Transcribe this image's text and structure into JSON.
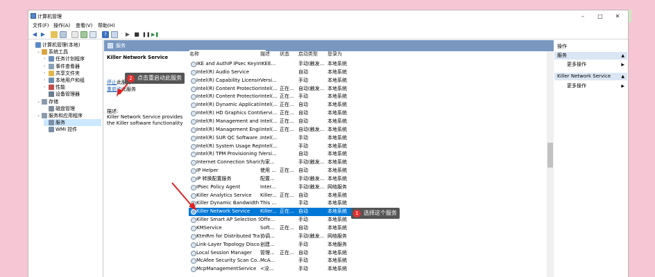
{
  "window": {
    "title": "计算机管理",
    "controls": {
      "minimize": "–",
      "maximize": "□",
      "close": "✕"
    }
  },
  "menu": [
    "文件(F)",
    "操作(A)",
    "查看(V)",
    "帮助(H)"
  ],
  "tree": {
    "items": [
      {
        "label": "计算机管理(本地)",
        "depth": 0,
        "expander": "",
        "icon_color": "#5a87c7",
        "selected": false
      },
      {
        "label": "系统工具",
        "depth": 1,
        "expander": "⌄",
        "icon_color": "#d9a441",
        "selected": false
      },
      {
        "label": "任务计划程序",
        "depth": 2,
        "expander": "›",
        "icon_color": "#6b8fb8",
        "selected": false
      },
      {
        "label": "事件查看器",
        "depth": 2,
        "expander": "›",
        "icon_color": "#8aa0b5",
        "selected": false
      },
      {
        "label": "共享文件夹",
        "depth": 2,
        "expander": "›",
        "icon_color": "#e0b84a",
        "selected": false
      },
      {
        "label": "本地用户和组",
        "depth": 2,
        "expander": "›",
        "icon_color": "#6c8eb0",
        "selected": false
      },
      {
        "label": "性能",
        "depth": 2,
        "expander": "›",
        "icon_color": "#c0504d",
        "selected": false
      },
      {
        "label": "设备管理器",
        "depth": 2,
        "expander": "",
        "icon_color": "#6b7d8f",
        "selected": false
      },
      {
        "label": "存储",
        "depth": 1,
        "expander": "⌄",
        "icon_color": "#8a9aab",
        "selected": false
      },
      {
        "label": "磁盘管理",
        "depth": 2,
        "expander": "",
        "icon_color": "#7f8c99",
        "selected": false
      },
      {
        "label": "服务和应用程序",
        "depth": 1,
        "expander": "⌄",
        "icon_color": "#8a9aab",
        "selected": false
      },
      {
        "label": "服务",
        "depth": 2,
        "expander": "",
        "icon_color": "#7b8fa6",
        "selected": true
      },
      {
        "label": "WMI 控件",
        "depth": 2,
        "expander": "",
        "icon_color": "#7b8fa6",
        "selected": false
      }
    ]
  },
  "services_header": "服务",
  "description": {
    "service_name": "Killer Network Service",
    "stop_link": "停止",
    "stop_suffix": "此服务",
    "restart_link": "重启动",
    "restart_suffix": "此服务",
    "label": "描述:",
    "text": "Killer Network Service provides the Killer software functionality"
  },
  "columns": [
    "名称",
    "描述",
    "状态",
    "启动类型",
    "登录为"
  ],
  "rows": [
    {
      "name": "IKE and AuthIP IPsec Keyin...",
      "desc": "IKEE...",
      "status": "",
      "startup": "手动(触发...",
      "logon": "本地系统",
      "selected": false
    },
    {
      "name": "Intel(R) Audio Service",
      "desc": "",
      "status": "",
      "startup": "自动",
      "logon": "本地系统",
      "selected": false
    },
    {
      "name": "Intel(R) Capability Licensin...",
      "desc": "Versi...",
      "status": "",
      "startup": "手动",
      "logon": "本地系统",
      "selected": false
    },
    {
      "name": "Intel(R) Content Protection...",
      "desc": "Intel(...",
      "status": "正在...",
      "startup": "自动(触发...",
      "logon": "本地系统",
      "selected": false
    },
    {
      "name": "Intel(R) Content Protection...",
      "desc": "Intel(...",
      "status": "正在...",
      "startup": "手动",
      "logon": "本地系统",
      "selected": false
    },
    {
      "name": "Intel(R) Dynamic Applicati...",
      "desc": "Intel(...",
      "status": "正在...",
      "startup": "自动",
      "logon": "本地系统",
      "selected": false
    },
    {
      "name": "Intel(R) HD Graphics Contr...",
      "desc": "Servi...",
      "status": "正在...",
      "startup": "自动",
      "logon": "本地系统",
      "selected": false
    },
    {
      "name": "Intel(R) Management and ...",
      "desc": "Intel(...",
      "status": "正在...",
      "startup": "自动",
      "logon": "本地系统",
      "selected": false
    },
    {
      "name": "Intel(R) Management Engi...",
      "desc": "Intel(...",
      "status": "正在...",
      "startup": "自动(触发...",
      "logon": "本地系统",
      "selected": false
    },
    {
      "name": "Intel(R) SUR QC Software ...",
      "desc": "Intel(...",
      "status": "",
      "startup": "手动",
      "logon": "本地系统",
      "selected": false
    },
    {
      "name": "Intel(R) System Usage Rep...",
      "desc": "Intel(...",
      "status": "",
      "startup": "手动",
      "logon": "本地系统",
      "selected": false
    },
    {
      "name": "Intel(R) TPM Provisioning S...",
      "desc": "Versi...",
      "status": "",
      "startup": "自动",
      "logon": "本地系统",
      "selected": false
    },
    {
      "name": "Internet Connection Sharin...",
      "desc": "为家...",
      "status": "",
      "startup": "手动(触发...",
      "logon": "本地系统",
      "selected": false
    },
    {
      "name": "IP Helper",
      "desc": "使用 ...",
      "status": "正在...",
      "startup": "自动",
      "logon": "本地系统",
      "selected": false
    },
    {
      "name": "IP 转换配置服务",
      "desc": "配置...",
      "status": "",
      "startup": "手动(触发...",
      "logon": "本地系统",
      "selected": false
    },
    {
      "name": "IPsec Policy Agent",
      "desc": "Inter...",
      "status": "",
      "startup": "手动(触发...",
      "logon": "网络服务",
      "selected": false
    },
    {
      "name": "Killer Analytics Service",
      "desc": "Killer...",
      "status": "正在...",
      "startup": "自动",
      "logon": "本地系统",
      "selected": false
    },
    {
      "name": "Killer Dynamic Bandwidth ...",
      "desc": "This ...",
      "status": "",
      "startup": "手动",
      "logon": "本地系统",
      "selected": false
    },
    {
      "name": "Killer Network Service",
      "desc": "Killer...",
      "status": "正在...",
      "startup": "自动",
      "logon": "本地系统",
      "selected": true
    },
    {
      "name": "Killer Smart AP Selection S...",
      "desc": "Offe...",
      "status": "",
      "startup": "手动",
      "logon": "本地系统",
      "selected": false
    },
    {
      "name": "KMService",
      "desc": "Soft...",
      "status": "正在...",
      "startup": "自动",
      "logon": "本地系统",
      "selected": false
    },
    {
      "name": "KtmRm for Distributed Tra...",
      "desc": "协调...",
      "status": "",
      "startup": "手动(触发...",
      "logon": "网络服务",
      "selected": false
    },
    {
      "name": "Link-Layer Topology Disco...",
      "desc": "创建...",
      "status": "",
      "startup": "手动",
      "logon": "本地服务",
      "selected": false
    },
    {
      "name": "Local Session Manager",
      "desc": "管理...",
      "status": "正在...",
      "startup": "自动",
      "logon": "本地系统",
      "selected": false
    },
    {
      "name": "McAfee Security Scan Co...",
      "desc": "McA...",
      "status": "",
      "startup": "手动",
      "logon": "本地系统",
      "selected": false
    },
    {
      "name": "McpManagementService",
      "desc": "<没...",
      "status": "",
      "startup": "手动",
      "logon": "本地系统",
      "selected": false
    }
  ],
  "actions": {
    "header": "操作",
    "sections": [
      {
        "title": "服务",
        "more": "更多操作"
      },
      {
        "title": "Killer Network Service",
        "more": "更多操作"
      }
    ]
  },
  "callouts": {
    "restart": {
      "badge": "2",
      "text": "点击重启动此服务"
    },
    "select": {
      "badge": "1",
      "text": "选择这个服务"
    }
  },
  "colors": {
    "selection": "#0078d7",
    "header_blue": "#7898c0",
    "callout_bg": "#555555",
    "badge_red": "#e53030",
    "arrow_red": "#e02020",
    "background_pink": "#f7c6d4"
  }
}
